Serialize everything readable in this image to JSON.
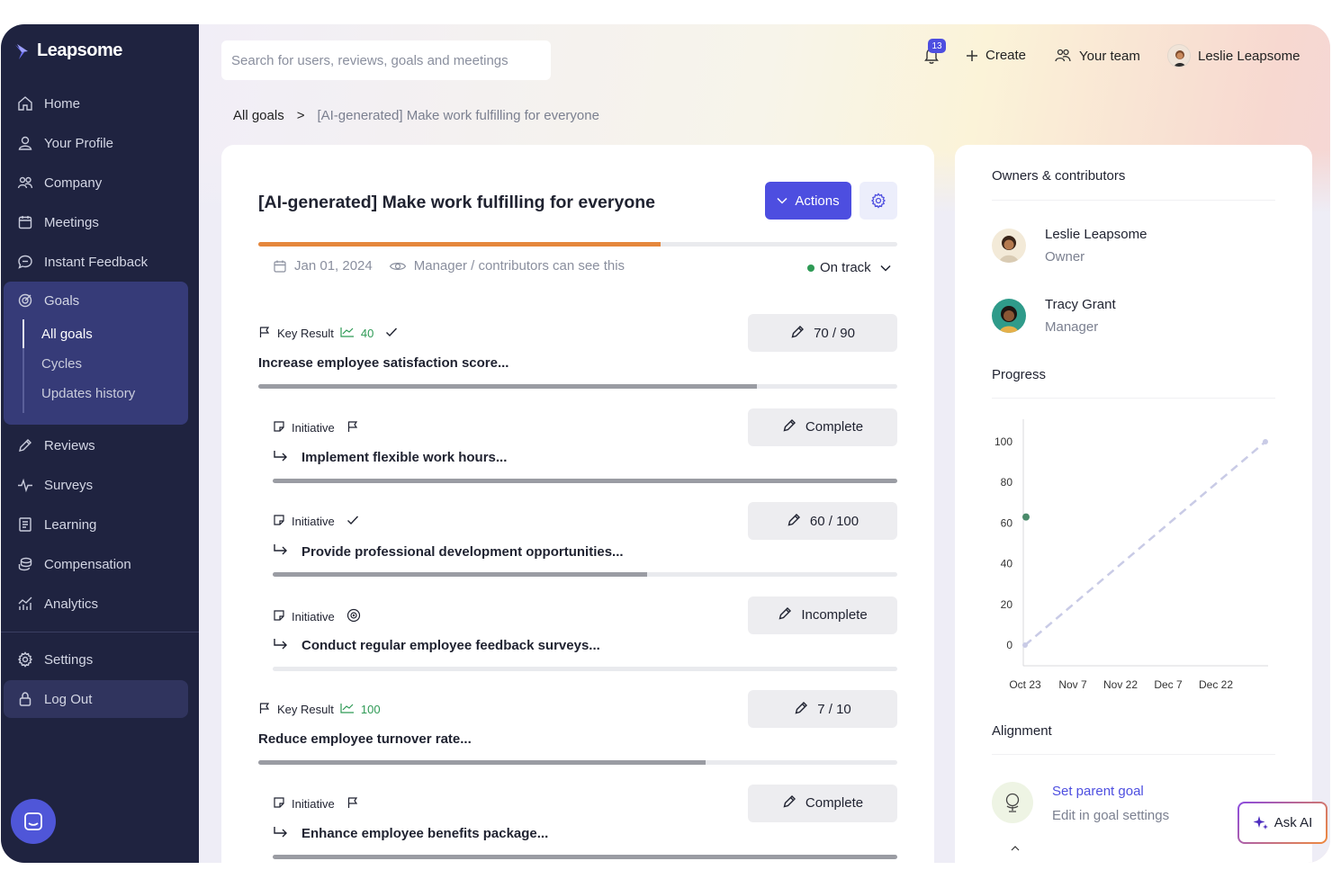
{
  "brand": {
    "name": "Leapsome"
  },
  "sidebar": {
    "items": [
      {
        "label": "Home",
        "icon": "home-icon"
      },
      {
        "label": "Your Profile",
        "icon": "user-icon"
      },
      {
        "label": "Company",
        "icon": "users-icon"
      },
      {
        "label": "Meetings",
        "icon": "calendar-icon"
      },
      {
        "label": "Instant Feedback",
        "icon": "chat-icon"
      },
      {
        "label": "Goals",
        "icon": "target-icon"
      },
      {
        "label": "Reviews",
        "icon": "pen-icon"
      },
      {
        "label": "Surveys",
        "icon": "pulse-icon"
      },
      {
        "label": "Learning",
        "icon": "book-icon"
      },
      {
        "label": "Compensation",
        "icon": "coins-icon"
      },
      {
        "label": "Analytics",
        "icon": "analytics-icon"
      },
      {
        "label": "Settings",
        "icon": "gear-icon"
      },
      {
        "label": "Log Out",
        "icon": "lock-icon"
      }
    ],
    "goals_sub": [
      "All goals",
      "Cycles",
      "Updates history"
    ]
  },
  "search": {
    "placeholder": "Search for users, reviews, goals and meetings"
  },
  "topbar": {
    "notification_count": "13",
    "create_label": "Create",
    "team_label": "Your team",
    "user_name": "Leslie Leapsome"
  },
  "breadcrumb": {
    "root": "All goals",
    "separator": ">",
    "current": "[AI-generated] Make work fulfilling for everyone"
  },
  "goal": {
    "title": "[AI-generated] Make work fulfilling for everyone",
    "actions_label": "Actions",
    "progress_fraction": 0.63,
    "date": "Jan 01, 2024",
    "visibility": "Manager / contributors can see this",
    "status": "On track",
    "status_color": "#2e9a55",
    "accent_color": "#4d4ee0"
  },
  "items": [
    {
      "kind": "Key Result",
      "target": "40",
      "state": "check",
      "title": "Increase employee satisfaction score...",
      "button": "70 / 90",
      "progress": 0.78
    },
    {
      "kind": "Initiative",
      "state": "flag",
      "title": "Implement flexible work hours...",
      "button": "Complete",
      "progress": 1.0
    },
    {
      "kind": "Initiative",
      "state": "check",
      "title": "Provide professional development opportunities...",
      "button": "60 / 100",
      "progress": 0.6
    },
    {
      "kind": "Initiative",
      "state": "target",
      "title": "Conduct regular employee feedback surveys...",
      "button": "Incomplete",
      "progress": 0
    },
    {
      "kind": "Key Result",
      "target": "100",
      "state": "none",
      "title": "Reduce employee turnover rate...",
      "button": "7 / 10",
      "progress": 0.7
    },
    {
      "kind": "Initiative",
      "state": "flag",
      "title": "Enhance employee benefits package...",
      "button": "Complete",
      "progress": 1.0
    }
  ],
  "right": {
    "owners_heading": "Owners & contributors",
    "people": [
      {
        "name": "Leslie Leapsome",
        "role": "Owner"
      },
      {
        "name": "Tracy Grant",
        "role": "Manager"
      }
    ],
    "progress_heading": "Progress",
    "alignment_heading": "Alignment",
    "set_parent": "Set parent goal",
    "edit_settings": "Edit in goal settings"
  },
  "ask_ai": "Ask AI",
  "chart_data": {
    "type": "line",
    "x_ticks": [
      "Oct 23",
      "Nov 7",
      "Nov 22",
      "Dec 7",
      "Dec 22"
    ],
    "ylim": [
      0,
      100
    ],
    "y_ticks": [
      0,
      20,
      40,
      60,
      80,
      100
    ],
    "series": [
      {
        "style": "dashed",
        "color": "#c9cbe6",
        "points": [
          [
            "Oct 23",
            0
          ],
          [
            "Dec 31",
            100
          ]
        ]
      },
      {
        "style": "point",
        "color": "#4a8a6a",
        "points": [
          [
            "Oct 23",
            63
          ]
        ]
      }
    ]
  }
}
